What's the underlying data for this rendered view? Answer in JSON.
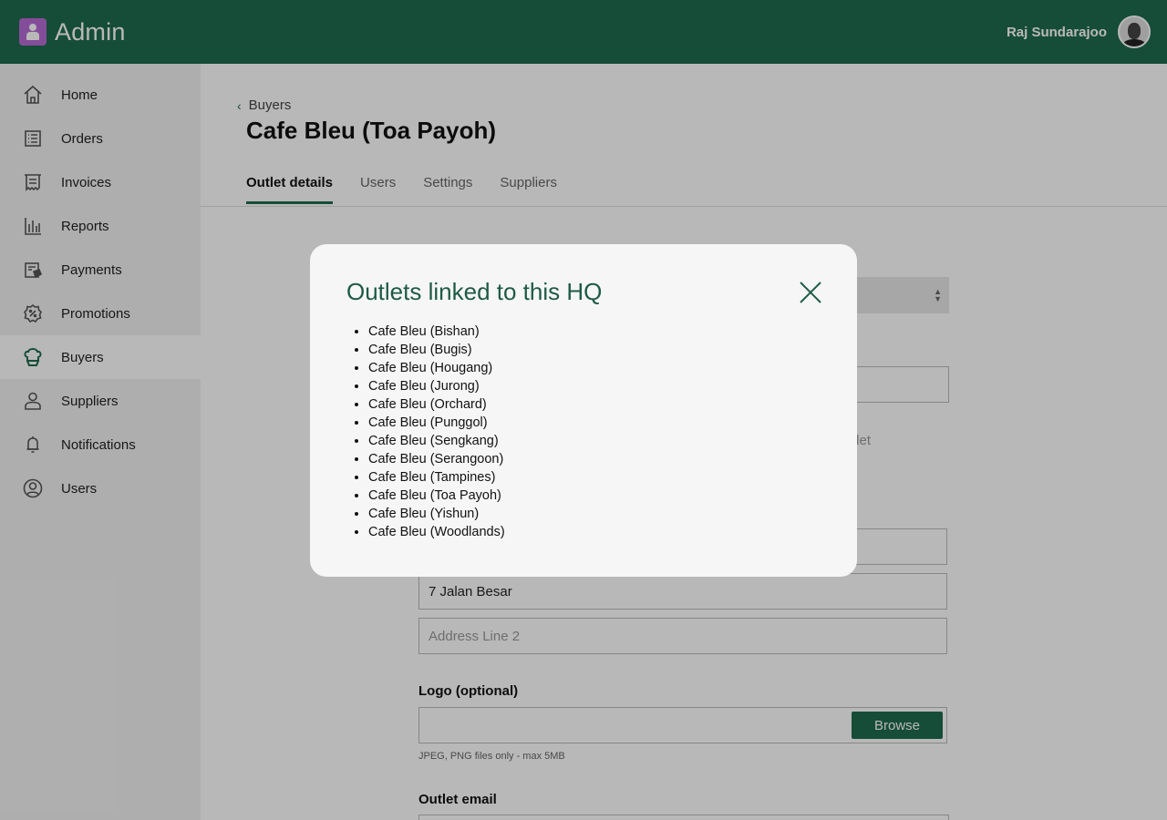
{
  "header": {
    "brand": "Admin",
    "user_name": "Raj Sundarajoo"
  },
  "sidebar": {
    "items": [
      {
        "label": "Home",
        "icon": "home-icon"
      },
      {
        "label": "Orders",
        "icon": "orders-icon"
      },
      {
        "label": "Invoices",
        "icon": "invoice-icon"
      },
      {
        "label": "Reports",
        "icon": "bar-chart-icon"
      },
      {
        "label": "Payments",
        "icon": "payment-icon"
      },
      {
        "label": "Promotions",
        "icon": "discount-icon"
      },
      {
        "label": "Buyers",
        "icon": "chef-hat-icon"
      },
      {
        "label": "Suppliers",
        "icon": "person-icon"
      },
      {
        "label": "Notifications",
        "icon": "bell-icon"
      },
      {
        "label": "Users",
        "icon": "user-circle-icon"
      }
    ],
    "active": "Buyers"
  },
  "main": {
    "breadcrumb": "Buyers",
    "title": "Cafe Bleu (Toa Payoh)",
    "tabs": [
      {
        "label": "Outlet details"
      },
      {
        "label": "Users"
      },
      {
        "label": "Settings"
      },
      {
        "label": "Suppliers"
      }
    ],
    "form": {
      "hint_partial": "tlet",
      "address_line1_value": "7 Jalan Besar",
      "address_line2_placeholder": "Address Line 2",
      "logo_label": "Logo (optional)",
      "browse_label": "Browse",
      "logo_hint": "JPEG, PNG files only - max 5MB",
      "outlet_email_label": "Outlet email"
    }
  },
  "modal": {
    "title": "Outlets linked to this HQ",
    "outlets": [
      "Cafe Bleu (Bishan)",
      "Cafe Bleu (Bugis)",
      "Cafe Bleu (Hougang)",
      "Cafe Bleu (Jurong)",
      "Cafe Bleu (Orchard)",
      "Cafe Bleu (Punggol)",
      "Cafe Bleu (Sengkang)",
      "Cafe Bleu (Serangoon)",
      "Cafe Bleu (Tampines)",
      "Cafe Bleu (Toa Payoh)",
      "Cafe Bleu (Yishun)",
      "Cafe Bleu (Woodlands)"
    ]
  },
  "colors": {
    "brand": "#1f6b4e",
    "logo": "#b86bd6",
    "modal_title": "#1f5a45"
  }
}
